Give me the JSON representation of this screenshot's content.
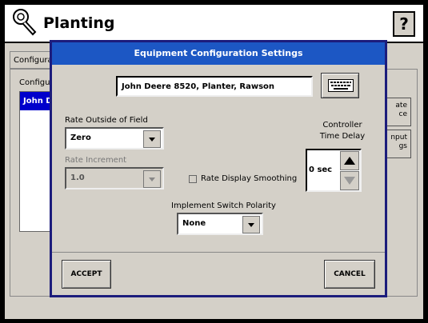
{
  "app": {
    "title": "Planting",
    "help_label": "?"
  },
  "background": {
    "tab_label": "Configura",
    "list_label": "Configu",
    "list_item": "John D",
    "side_button_1": "ate\nce",
    "side_button_2": "nput\ngs"
  },
  "dialog": {
    "title": "Equipment Configuration Settings",
    "config_name": "John Deere 8520, Planter, Rawson",
    "rate_outside_label": "Rate Outside of Field",
    "rate_outside_value": "Zero",
    "rate_increment_label": "Rate Increment",
    "rate_increment_value": "1.0",
    "smoothing_label": "Rate Display Smoothing",
    "smoothing_checked": false,
    "controller_label_line1": "Controller",
    "controller_label_line2": "Time Delay",
    "controller_value": "0 sec",
    "polarity_label": "Implement Switch Polarity",
    "polarity_value": "None",
    "accept_label": "ACCEPT",
    "cancel_label": "CANCEL"
  },
  "colors": {
    "title_bar": "#1c57c4",
    "dialog_border": "#1c1c7c",
    "selection": "#0000cc"
  },
  "icons": [
    "wrench-icon",
    "keyboard-icon",
    "up-arrow-icon",
    "down-arrow-icon",
    "dropdown-arrow-icon"
  ]
}
